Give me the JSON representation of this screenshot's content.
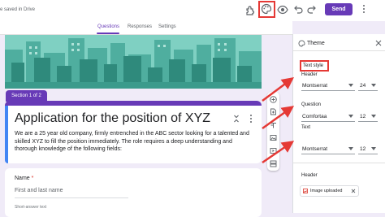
{
  "topbar": {
    "status": "e saved in Drive",
    "send_label": "Send",
    "icons": [
      "addon-icon",
      "palette-icon",
      "preview-icon",
      "undo-icon",
      "redo-icon",
      "more-icon"
    ]
  },
  "tabs": [
    {
      "label": "Questions",
      "active": true
    },
    {
      "label": "Responses",
      "active": false
    },
    {
      "label": "Settings",
      "active": false
    }
  ],
  "section": {
    "tag": "Section 1 of 2"
  },
  "form": {
    "title": "Application for the position of XYZ",
    "description": "We are a 25 year old company, firmly entrenched in the ABC sector looking for a talented and skilled XYZ to fill the position immediately. The role requires a deep understanding and thorough knowledge of the following fields:"
  },
  "question": {
    "label": "Name",
    "required_mark": "*",
    "placeholder": "First and last name",
    "hint": "Short-answer text"
  },
  "float_toolbar": [
    "add-question-icon",
    "import-questions-icon",
    "add-title-icon",
    "add-image-icon",
    "add-video-icon",
    "add-section-icon"
  ],
  "theme_panel": {
    "title": "Theme",
    "text_style_label": "Text style",
    "header": {
      "label": "Header",
      "font": "Montserrat",
      "size": "24"
    },
    "question": {
      "label": "Question",
      "font": "Comfortaa",
      "size": "12"
    },
    "text": {
      "label": "Text",
      "font": "Montserrat",
      "size": "12"
    },
    "header_image": {
      "label": "Header",
      "chip": "Image uploaded"
    }
  },
  "colors": {
    "accent": "#673ab7",
    "highlight": "#e53935",
    "banner": "#6fc3b6",
    "background": "#f0ebf8"
  }
}
